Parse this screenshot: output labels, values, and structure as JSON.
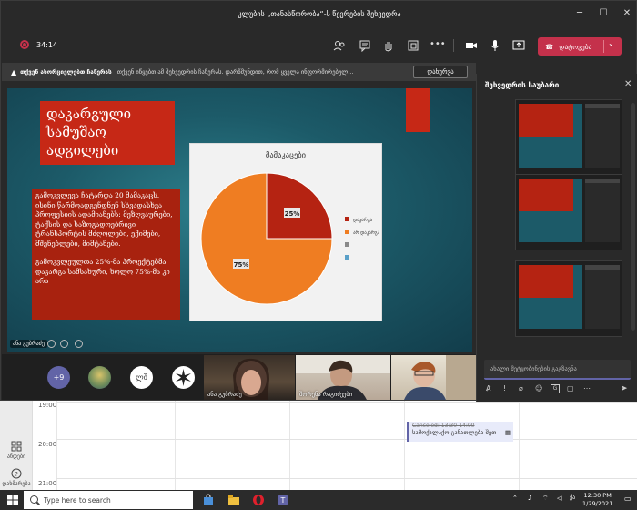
{
  "window": {
    "title": "კლუბის „თანასწორობა“-ს წევრების შეხვედრა"
  },
  "toolbar": {
    "timer": "34:14",
    "leave_label": "დატოვება"
  },
  "notice": {
    "bold_text": "თქვენ ახორციელებთ ჩაწერას",
    "text": "თქვენ იწყებთ ამ შეხვედრის ჩაწერას. დარწმუნდით, რომ ყველა ინფორმირებულ...",
    "dismiss_label": "დახურვა"
  },
  "slide": {
    "title": "დაკარგული სამუშაო ადგილები",
    "body_paragraph_1": "გამოკვლევა ჩატარდა 20 მამაკაცს. ისინი წარმოადგენდნენ სხვადასხვა პროფესიის ადამიანებს: მეზღვაურები, ტაქსის და საზოგადოებრივი ტრანსპორტის მძღოლები, ექიმები, მშენებლები, მიმტანები.",
    "body_paragraph_2": "გამოკვლეულთა 25%-მა პროექტებმა დაკარგა სამსახური, ხოლო 75%-მა კი არა",
    "presenter": "ანა გუბრაძე"
  },
  "chart_data": {
    "type": "pie",
    "title": "მამაკაცები",
    "slices": [
      {
        "label": "დაკარგა",
        "value": 25,
        "color": "#b52312"
      },
      {
        "label": "არ დაკარგა",
        "value": 75,
        "color": "#ef7d22"
      }
    ],
    "data_labels": [
      "25%",
      "75%"
    ],
    "legend_position": "right",
    "legend_extra_colors": [
      "#8a8a8a",
      "#5aa0c8"
    ]
  },
  "video": {
    "more_count": "+9",
    "avatar_initials": "ლშ",
    "participants": [
      {
        "name": "ანა გუბრაძე"
      },
      {
        "name": "შორენა რაგიძეები"
      },
      {
        "name": ""
      }
    ]
  },
  "panel": {
    "title": "შეხვედრის საუბარი",
    "compose_placeholder": "ახალი შეტყობინების გაგზავნა"
  },
  "calendar": {
    "times": [
      "19:00",
      "20:00",
      "21:00"
    ],
    "event_canceled": "Canceled: 13:30-14:00",
    "event_title": "სამოქალაქო განათლება შეთ",
    "rail": [
      {
        "label": "ანდები"
      },
      {
        "label": "დახმარება"
      }
    ]
  },
  "taskbar": {
    "search_placeholder": "Type here to search",
    "time": "12:30 PM",
    "date": "1/29/2021"
  },
  "colors": {
    "accent": "#6264a7",
    "leave": "#c4314b",
    "slide_red": "#c62816"
  }
}
